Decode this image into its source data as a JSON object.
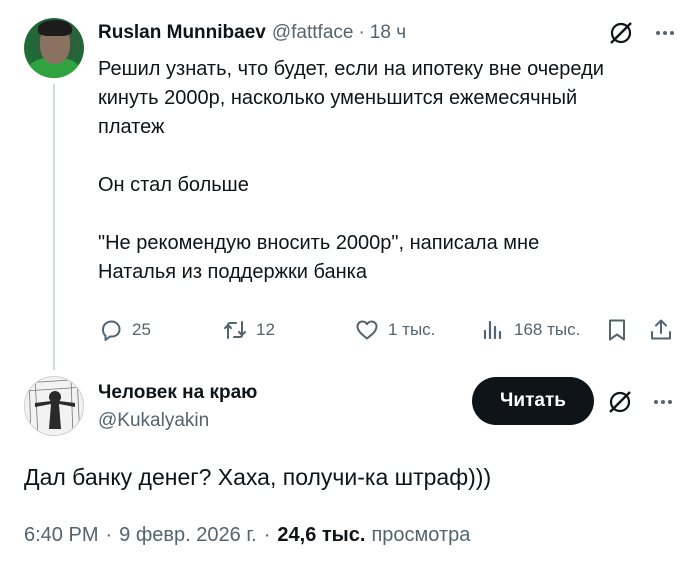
{
  "tweet": {
    "author_name": "Ruslan Munnibaev",
    "author_handle": "@fattface",
    "separator": "·",
    "time_ago": "18 ч",
    "text": "Решил узнать, что будет, если на ипотеку вне очереди\nкинуть 2000р, насколько уменьшится ежемесячный\nплатеж\n\nОн стал больше\n\n\"Не рекомендую вносить 2000р\", написала мне\nНаталья из поддержки банка",
    "stats": {
      "replies": "25",
      "reposts": "12",
      "likes": "1 тыс.",
      "views": "168 тыс."
    },
    "icons": [
      "grok-icon",
      "more-icon",
      "reply-icon",
      "repost-icon",
      "like-icon",
      "views-icon",
      "bookmark-icon",
      "share-icon"
    ]
  },
  "reply": {
    "author_name": "Человек на краю",
    "author_handle": "@Kukalyakin",
    "follow_label": "Читать",
    "text": "Дал банку денег? Хаха, получи-ка штраф)))",
    "time": "6:40 PM",
    "separator": "·",
    "date": "9 февр. 2026 г.",
    "views_count": "24,6 тыс.",
    "views_label": "просмотра"
  },
  "colors": {
    "text": "#0f1419",
    "secondary": "#536471",
    "thread_line": "#cfd9de",
    "button_bg": "#0f1419",
    "button_text": "#ffffff"
  }
}
